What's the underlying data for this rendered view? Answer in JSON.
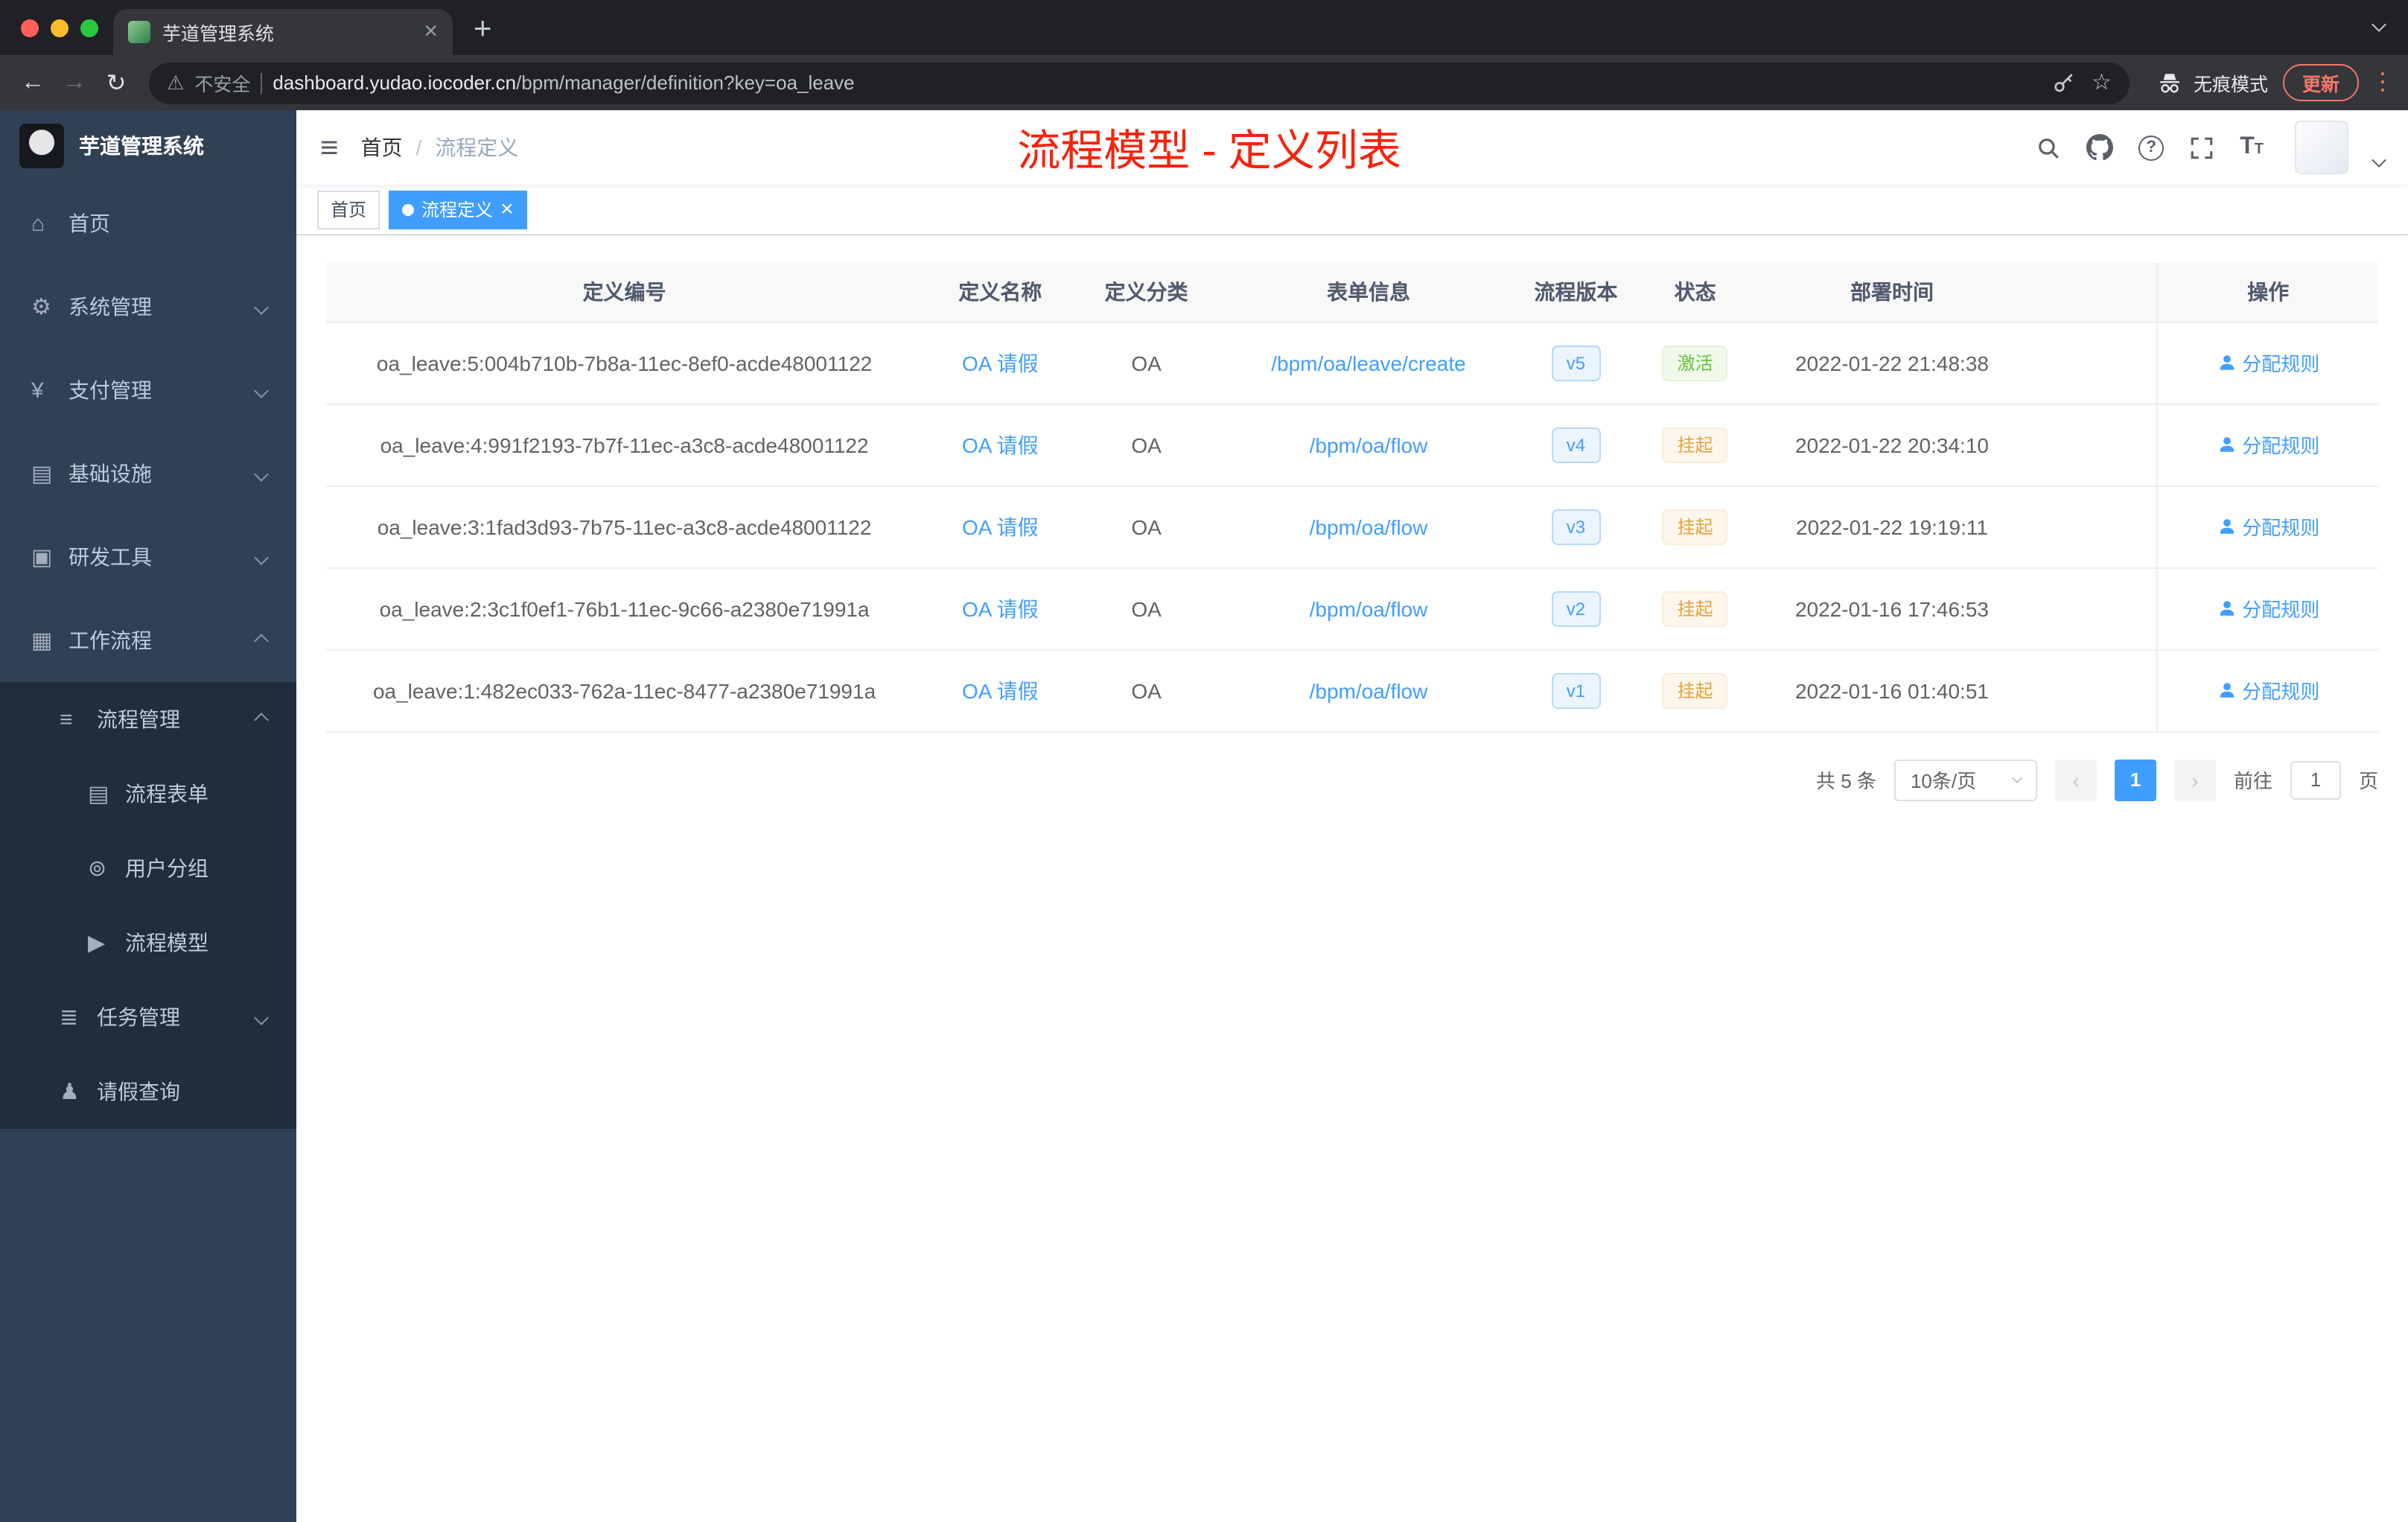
{
  "colors": {
    "accent": "#409eff",
    "annotation": "#f8220c",
    "sidebarBg": "#304156",
    "submenuBg": "#1f2d3d",
    "activeTag": "#409eff",
    "trafficRed": "#ff5f57",
    "trafficYellow": "#febc2e",
    "trafficGreen": "#28c840"
  },
  "browser": {
    "tab_title": "芋道管理系统",
    "security_label": "不安全",
    "url_domain": "dashboard.yudao.iocoder.cn",
    "url_path": "/bpm/manager/definition?key=oa_leave",
    "incognito_label": "无痕模式",
    "update_label": "更新"
  },
  "sidebar": {
    "app_title": "芋道管理系统",
    "items": [
      {
        "key": "home",
        "label": "首页",
        "glyph": "⌂",
        "icon": "home-icon",
        "depth": 0
      },
      {
        "key": "system-management",
        "label": "系统管理",
        "glyph": "⚙",
        "icon": "gear-icon",
        "depth": 0,
        "chevron": "down"
      },
      {
        "key": "payment-management",
        "label": "支付管理",
        "glyph": "¥",
        "icon": "yen-icon",
        "depth": 0,
        "chevron": "down"
      },
      {
        "key": "infrastructure",
        "label": "基础设施",
        "glyph": "▤",
        "icon": "infrastructure-icon",
        "depth": 0,
        "chevron": "down"
      },
      {
        "key": "dev-tools",
        "label": "研发工具",
        "glyph": "▣",
        "icon": "dev-tools-icon",
        "depth": 0,
        "chevron": "down"
      },
      {
        "key": "workflow",
        "label": "工作流程",
        "glyph": "▦",
        "icon": "workflow-icon",
        "depth": 0,
        "chevron": "up"
      },
      {
        "key": "process-management",
        "label": "流程管理",
        "glyph": "≡",
        "icon": "process-list-icon",
        "depth": 1,
        "chevron": "up",
        "sub": true
      },
      {
        "key": "process-form",
        "label": "流程表单",
        "glyph": "▤",
        "icon": "form-icon",
        "depth": 2,
        "sub": true
      },
      {
        "key": "user-group",
        "label": "用户分组",
        "glyph": "⊚",
        "icon": "user-group-icon",
        "depth": 2,
        "sub": true
      },
      {
        "key": "process-model",
        "label": "流程模型",
        "glyph": "▶",
        "icon": "send-icon",
        "depth": 2,
        "sub": true
      },
      {
        "key": "task-management",
        "label": "任务管理",
        "glyph": "≣",
        "icon": "task-icon",
        "depth": 1,
        "chevron": "down",
        "sub": true
      },
      {
        "key": "leave-query",
        "label": "请假查询",
        "glyph": "♟",
        "icon": "user-icon",
        "depth": 1,
        "sub": true
      }
    ]
  },
  "navbar": {
    "breadcrumb": [
      "首页",
      "流程定义"
    ],
    "separator": "/",
    "annotation": "流程模型 - 定义列表"
  },
  "tags": [
    {
      "label": "首页",
      "active": false,
      "closable": false
    },
    {
      "label": "流程定义",
      "active": true,
      "closable": true
    }
  ],
  "table": {
    "columns": [
      "定义编号",
      "定义名称",
      "定义分类",
      "表单信息",
      "流程版本",
      "状态",
      "部署时间",
      "操作"
    ],
    "rows": [
      {
        "id": "oa_leave:5:004b710b-7b8a-11ec-8ef0-acde48001122",
        "name": "OA 请假",
        "category": "OA",
        "form": "/bpm/oa/leave/create",
        "version": "v5",
        "status": "激活",
        "status_type": "success",
        "time": "2022-01-22 21:48:38",
        "action": "分配规则"
      },
      {
        "id": "oa_leave:4:991f2193-7b7f-11ec-a3c8-acde48001122",
        "name": "OA 请假",
        "category": "OA",
        "form": "/bpm/oa/flow",
        "version": "v4",
        "status": "挂起",
        "status_type": "warning",
        "time": "2022-01-22 20:34:10",
        "action": "分配规则"
      },
      {
        "id": "oa_leave:3:1fad3d93-7b75-11ec-a3c8-acde48001122",
        "name": "OA 请假",
        "category": "OA",
        "form": "/bpm/oa/flow",
        "version": "v3",
        "status": "挂起",
        "status_type": "warning",
        "time": "2022-01-22 19:19:11",
        "action": "分配规则"
      },
      {
        "id": "oa_leave:2:3c1f0ef1-76b1-11ec-9c66-a2380e71991a",
        "name": "OA 请假",
        "category": "OA",
        "form": "/bpm/oa/flow",
        "version": "v2",
        "status": "挂起",
        "status_type": "warning",
        "time": "2022-01-16 17:46:53",
        "action": "分配规则"
      },
      {
        "id": "oa_leave:1:482ec033-762a-11ec-8477-a2380e71991a",
        "name": "OA 请假",
        "category": "OA",
        "form": "/bpm/oa/flow",
        "version": "v1",
        "status": "挂起",
        "status_type": "warning",
        "time": "2022-01-16 01:40:51",
        "action": "分配规则"
      }
    ]
  },
  "pagination": {
    "total": "共 5 条",
    "page_size": "10条/页",
    "active_page": "1",
    "goto_prefix": "前往",
    "goto_value": "1",
    "goto_suffix": "页"
  }
}
